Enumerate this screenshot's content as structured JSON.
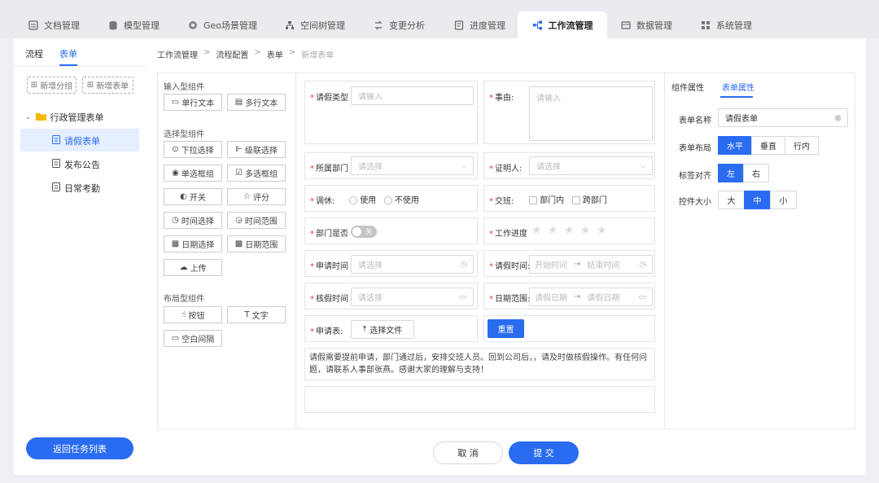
{
  "tabs": [
    {
      "label": "文档管理",
      "icon": "document-icon"
    },
    {
      "label": "模型管理",
      "icon": "database-icon"
    },
    {
      "label": "Geo场景管理",
      "icon": "globe-icon"
    },
    {
      "label": "空间树管理",
      "icon": "tree-icon"
    },
    {
      "label": "变更分析",
      "icon": "compare-icon"
    },
    {
      "label": "进度管理",
      "icon": "progress-icon"
    },
    {
      "label": "工作流管理",
      "icon": "workflow-icon"
    },
    {
      "label": "数据管理",
      "icon": "data-icon"
    },
    {
      "label": "系统管理",
      "icon": "settings-icon"
    }
  ],
  "sidebar": {
    "tab_flow": "流程",
    "tab_form": "表单",
    "add_group": "新增分组",
    "add_form": "新增表单",
    "folder": "行政管理表单",
    "items": [
      "请假表单",
      "发布公告",
      "日常考勤"
    ],
    "back_button": "返回任务列表"
  },
  "breadcrumb": [
    "工作流管理",
    "流程配置",
    "表单",
    "新增表单"
  ],
  "breadcrumb_sep": ">",
  "palette": {
    "input_title": "输入型组件",
    "input_items": [
      "单行文本",
      "多行文本"
    ],
    "select_title": "选择型组件",
    "select_items": [
      "下拉选择",
      "级联选择",
      "单选框组",
      "多选框组",
      "开关",
      "评分",
      "时间选择",
      "时间范围",
      "日期选择",
      "日期范围",
      "上传"
    ],
    "layout_title": "布局型组件",
    "layout_items": [
      "按钮",
      "文字",
      "空白间隔"
    ]
  },
  "form": {
    "leave_type": {
      "label": "请假类型",
      "placeholder": "请输入"
    },
    "reason": {
      "label": "事由:",
      "placeholder": "请输入"
    },
    "department": {
      "label": "所属部门",
      "placeholder": "请选择"
    },
    "witness": {
      "label": "证明人:",
      "placeholder": "请选择"
    },
    "rest": {
      "label": "调休:",
      "opt1": "使用",
      "opt2": "不使用"
    },
    "handover": {
      "label": "交班:",
      "opt1": "部门内",
      "opt2": "跨部门"
    },
    "dept_yes": {
      "label": "部门是否",
      "switch_text": "关"
    },
    "progress": {
      "label": "工作进度"
    },
    "apply_time": {
      "label": "申请时间",
      "placeholder": "请选择"
    },
    "leave_time": {
      "label": "请假时间:",
      "start": "开始时间",
      "arrow": "→",
      "end": "结束时间"
    },
    "cancel_time": {
      "label": "核假时间",
      "placeholder": "请选择"
    },
    "date_range": {
      "label": "日期范围:",
      "start": "请假日期",
      "arrow": "→",
      "end": "请假日期"
    },
    "apply_form": {
      "label": "申请表:",
      "button": "选择文件"
    },
    "reset_button": "重置",
    "notice": "请假需要提前申请，部门通过后，安排交班人员。回到公司后，，请及时做核假操作。有任何问题，请联系人事部张燕。感谢大家的理解与支持！"
  },
  "props": {
    "tab_component": "组件属性",
    "tab_form": "表单属性",
    "name_label": "表单名称",
    "name_value": "请假表单",
    "layout_label": "表单布局",
    "layout_options": [
      "水平",
      "垂直",
      "行内"
    ],
    "layout_selected": "水平",
    "align_label": "标签对齐",
    "align_options": [
      "左",
      "右"
    ],
    "align_selected": "左",
    "size_label": "控件大小",
    "size_options": [
      "大",
      "中",
      "小"
    ],
    "size_selected": "中"
  },
  "footer": {
    "cancel": "取 消",
    "submit": "提 交"
  },
  "colors": {
    "accent": "#2a6cf0",
    "required": "#e53935",
    "folder": "#f5b800"
  }
}
